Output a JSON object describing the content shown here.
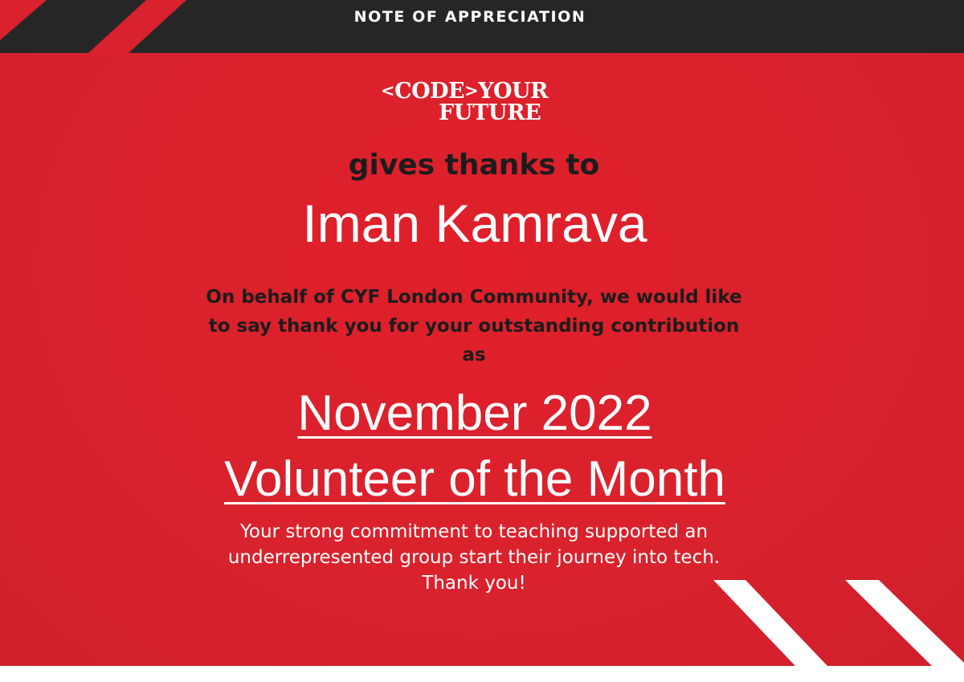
{
  "header": {
    "title": "NOTE OF APPRECIATION"
  },
  "logo": {
    "open_bracket": "<",
    "code": "CODE",
    "close_bracket": ">",
    "your": "YOUR",
    "future": "FUTURE"
  },
  "certificate": {
    "intro": "gives thanks to",
    "recipient": "Iman Kamrava",
    "message": "On behalf of CYF London Community, we would like to say thank you for your outstanding contribution as",
    "award_month": "November 2022",
    "award_title": "Volunteer of the Month",
    "commitment": "Your strong commitment to teaching supported an underrepresented group start their journey into tech. Thank you!"
  },
  "colors": {
    "background_red": "#d9222d",
    "header_black": "#262626",
    "text_white": "#ffffff",
    "text_dark": "#1c1c1c"
  }
}
